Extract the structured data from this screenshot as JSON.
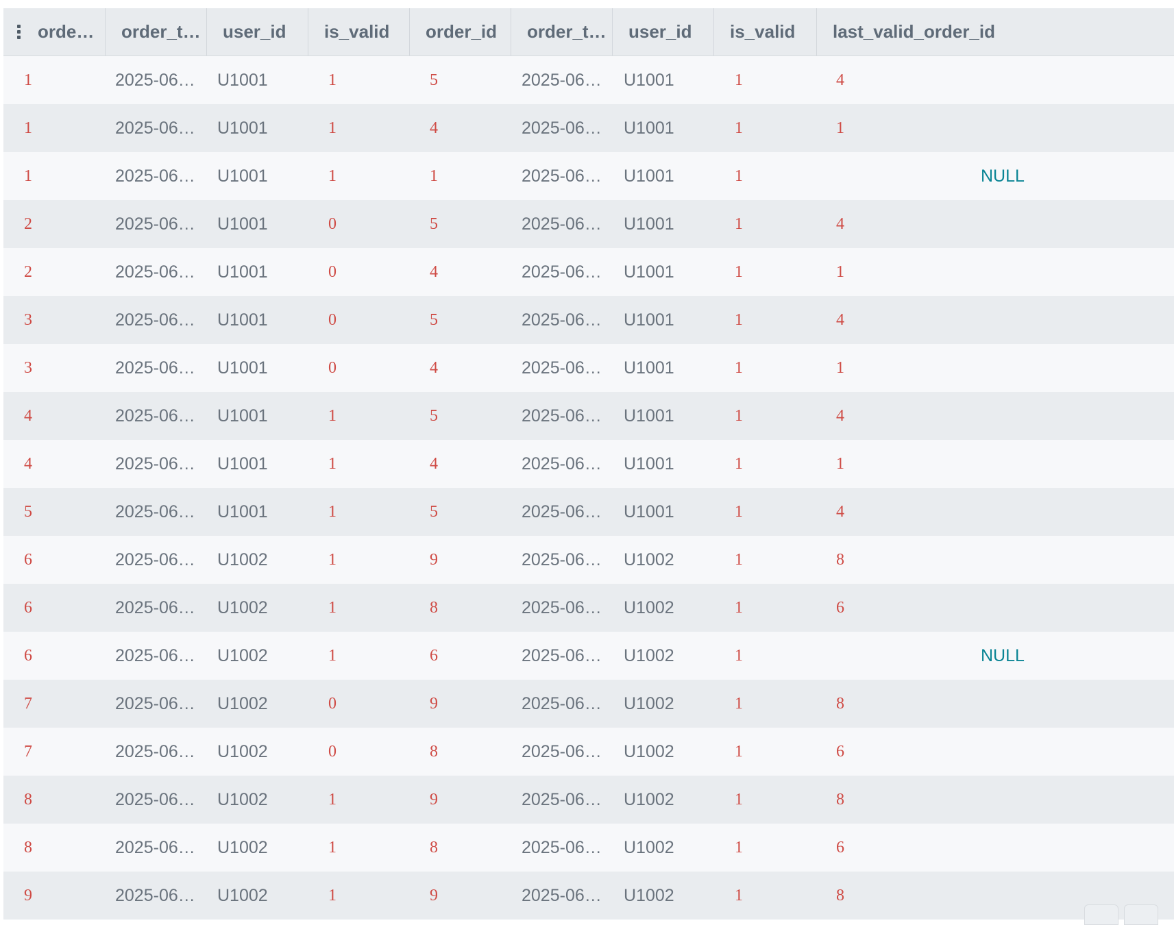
{
  "columns": [
    {
      "label": "orde…"
    },
    {
      "label": "order_t…"
    },
    {
      "label": "user_id"
    },
    {
      "label": "is_valid"
    },
    {
      "label": "order_id"
    },
    {
      "label": "order_t…"
    },
    {
      "label": "user_id"
    },
    {
      "label": "is_valid"
    },
    {
      "label": "last_valid_order_id"
    }
  ],
  "rows": [
    {
      "order_id": "1",
      "order_time": "2025-06…",
      "user_id": "U1001",
      "is_valid": "1",
      "order_id_2": "5",
      "order_time_2": "2025-06…",
      "user_id_2": "U1001",
      "is_valid_2": "1",
      "last_valid_order_id": "4"
    },
    {
      "order_id": "1",
      "order_time": "2025-06…",
      "user_id": "U1001",
      "is_valid": "1",
      "order_id_2": "4",
      "order_time_2": "2025-06…",
      "user_id_2": "U1001",
      "is_valid_2": "1",
      "last_valid_order_id": "1"
    },
    {
      "order_id": "1",
      "order_time": "2025-06…",
      "user_id": "U1001",
      "is_valid": "1",
      "order_id_2": "1",
      "order_time_2": "2025-06…",
      "user_id_2": "U1001",
      "is_valid_2": "1",
      "last_valid_order_id": "NULL"
    },
    {
      "order_id": "2",
      "order_time": "2025-06…",
      "user_id": "U1001",
      "is_valid": "0",
      "order_id_2": "5",
      "order_time_2": "2025-06…",
      "user_id_2": "U1001",
      "is_valid_2": "1",
      "last_valid_order_id": "4"
    },
    {
      "order_id": "2",
      "order_time": "2025-06…",
      "user_id": "U1001",
      "is_valid": "0",
      "order_id_2": "4",
      "order_time_2": "2025-06…",
      "user_id_2": "U1001",
      "is_valid_2": "1",
      "last_valid_order_id": "1"
    },
    {
      "order_id": "3",
      "order_time": "2025-06…",
      "user_id": "U1001",
      "is_valid": "0",
      "order_id_2": "5",
      "order_time_2": "2025-06…",
      "user_id_2": "U1001",
      "is_valid_2": "1",
      "last_valid_order_id": "4"
    },
    {
      "order_id": "3",
      "order_time": "2025-06…",
      "user_id": "U1001",
      "is_valid": "0",
      "order_id_2": "4",
      "order_time_2": "2025-06…",
      "user_id_2": "U1001",
      "is_valid_2": "1",
      "last_valid_order_id": "1"
    },
    {
      "order_id": "4",
      "order_time": "2025-06…",
      "user_id": "U1001",
      "is_valid": "1",
      "order_id_2": "5",
      "order_time_2": "2025-06…",
      "user_id_2": "U1001",
      "is_valid_2": "1",
      "last_valid_order_id": "4"
    },
    {
      "order_id": "4",
      "order_time": "2025-06…",
      "user_id": "U1001",
      "is_valid": "1",
      "order_id_2": "4",
      "order_time_2": "2025-06…",
      "user_id_2": "U1001",
      "is_valid_2": "1",
      "last_valid_order_id": "1"
    },
    {
      "order_id": "5",
      "order_time": "2025-06…",
      "user_id": "U1001",
      "is_valid": "1",
      "order_id_2": "5",
      "order_time_2": "2025-06…",
      "user_id_2": "U1001",
      "is_valid_2": "1",
      "last_valid_order_id": "4"
    },
    {
      "order_id": "6",
      "order_time": "2025-06…",
      "user_id": "U1002",
      "is_valid": "1",
      "order_id_2": "9",
      "order_time_2": "2025-06…",
      "user_id_2": "U1002",
      "is_valid_2": "1",
      "last_valid_order_id": "8"
    },
    {
      "order_id": "6",
      "order_time": "2025-06…",
      "user_id": "U1002",
      "is_valid": "1",
      "order_id_2": "8",
      "order_time_2": "2025-06…",
      "user_id_2": "U1002",
      "is_valid_2": "1",
      "last_valid_order_id": "6"
    },
    {
      "order_id": "6",
      "order_time": "2025-06…",
      "user_id": "U1002",
      "is_valid": "1",
      "order_id_2": "6",
      "order_time_2": "2025-06…",
      "user_id_2": "U1002",
      "is_valid_2": "1",
      "last_valid_order_id": "NULL"
    },
    {
      "order_id": "7",
      "order_time": "2025-06…",
      "user_id": "U1002",
      "is_valid": "0",
      "order_id_2": "9",
      "order_time_2": "2025-06…",
      "user_id_2": "U1002",
      "is_valid_2": "1",
      "last_valid_order_id": "8"
    },
    {
      "order_id": "7",
      "order_time": "2025-06…",
      "user_id": "U1002",
      "is_valid": "0",
      "order_id_2": "8",
      "order_time_2": "2025-06…",
      "user_id_2": "U1002",
      "is_valid_2": "1",
      "last_valid_order_id": "6"
    },
    {
      "order_id": "8",
      "order_time": "2025-06…",
      "user_id": "U1002",
      "is_valid": "1",
      "order_id_2": "9",
      "order_time_2": "2025-06…",
      "user_id_2": "U1002",
      "is_valid_2": "1",
      "last_valid_order_id": "8"
    },
    {
      "order_id": "8",
      "order_time": "2025-06…",
      "user_id": "U1002",
      "is_valid": "1",
      "order_id_2": "8",
      "order_time_2": "2025-06…",
      "user_id_2": "U1002",
      "is_valid_2": "1",
      "last_valid_order_id": "6"
    },
    {
      "order_id": "9",
      "order_time": "2025-06…",
      "user_id": "U1002",
      "is_valid": "1",
      "order_id_2": "9",
      "order_time_2": "2025-06…",
      "user_id_2": "U1002",
      "is_valid_2": "1",
      "last_valid_order_id": "8"
    }
  ],
  "colors": {
    "number": "#cf4b45",
    "string": "#6a737d",
    "null": "#0b8595",
    "header_bg": "#e8ebee",
    "row_light": "#f7f8fa",
    "row_dark": "#e9ecef"
  },
  "icons": {
    "column_menu": "vertical-dots-icon",
    "bottom_add": "plus-icon",
    "bottom_grid": "grid-icon"
  }
}
